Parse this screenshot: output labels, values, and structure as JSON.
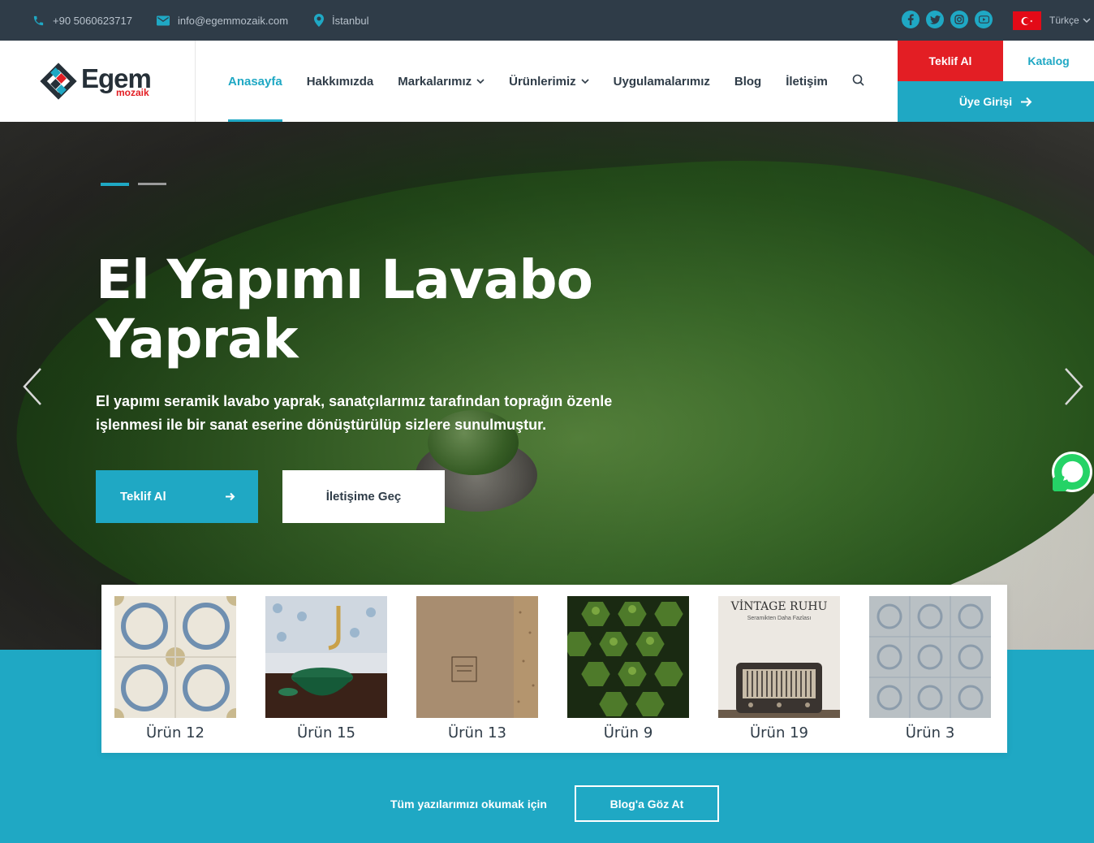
{
  "topbar": {
    "phone": "+90 5060623717",
    "email": "info@egemmozaik.com",
    "location": "İstanbul",
    "language": "Türkçe",
    "socials": [
      "facebook-icon",
      "twitter-icon",
      "instagram-icon",
      "youtube-icon"
    ]
  },
  "brand": {
    "name": "Egem",
    "sub": "mozaik"
  },
  "nav": {
    "items": [
      {
        "label": "Anasayfa",
        "active": true
      },
      {
        "label": "Hakkımızda"
      },
      {
        "label": "Markalarımız",
        "dropdown": true
      },
      {
        "label": "Ürünlerimiz",
        "dropdown": true
      },
      {
        "label": "Uygulamalarımız"
      },
      {
        "label": "Blog"
      },
      {
        "label": "İletişim"
      }
    ]
  },
  "header_buttons": {
    "quote": "Teklif Al",
    "catalog": "Katalog",
    "member": "Üye Girişi"
  },
  "hero": {
    "title_line1": "El Yapımı Lavabo",
    "title_line2": "Yaprak",
    "description": "El yapımı seramik lavabo yaprak, sanatçılarımız tarafından toprağın özenle işlenmesi ile bir sanat eserine dönüştürülüp sizlere sunulmuştur.",
    "cta_primary": "Teklif Al",
    "cta_secondary": "İletişime Geç",
    "slides": 2,
    "active_slide": 1
  },
  "products": [
    {
      "name": "Ürün 12"
    },
    {
      "name": "Ürün 15"
    },
    {
      "name": "Ürün 13"
    },
    {
      "name": "Ürün 9"
    },
    {
      "name": "Ürün 19"
    },
    {
      "name": "Ürün 3"
    }
  ],
  "product_texts": {
    "vintage_title": "VİNTAGE RUHU",
    "vintage_sub": "Seramikten Daha Fazlası"
  },
  "blog": {
    "text": "Tüm yazılarımızı okumak için",
    "button": "Blog'a Göz At"
  },
  "colors": {
    "accent": "#1fa8c4",
    "brand_red": "#e31e24",
    "dark": "#2f3c48"
  }
}
